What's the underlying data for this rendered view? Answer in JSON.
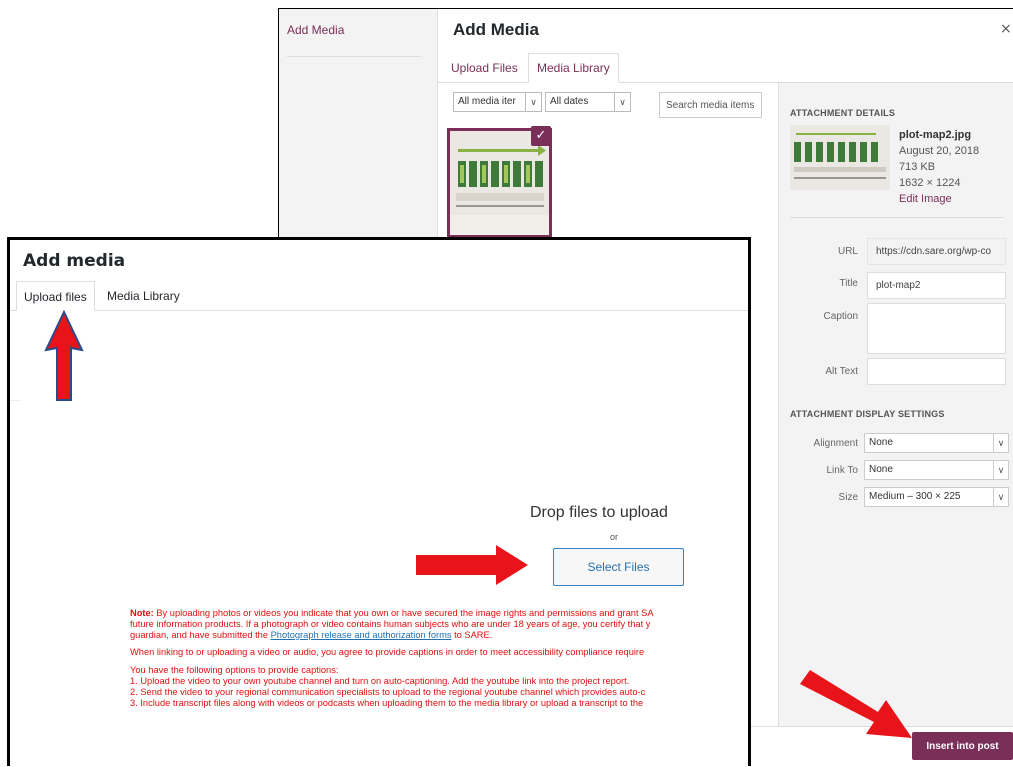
{
  "back_modal": {
    "menu_item": "Add Media",
    "title": "Add Media",
    "close_symbol": "×",
    "tabs": [
      "Upload Files",
      "Media Library"
    ],
    "filters": {
      "type": "All media iter",
      "date": "All dates"
    },
    "search_placeholder": "Search media items",
    "details": {
      "heading": "ATTACHMENT DETAILS",
      "filename": "plot-map2.jpg",
      "date": "August 20, 2018",
      "size": "713 KB",
      "dimensions": "1632 × 1224",
      "edit_link": "Edit Image",
      "url_label": "URL",
      "url_value": "https://cdn.sare.org/wp-co",
      "title_label": "Title",
      "title_value": "plot-map2",
      "caption_label": "Caption",
      "alt_label": "Alt Text"
    },
    "display": {
      "heading": "ATTACHMENT DISPLAY SETTINGS",
      "alignment_label": "Alignment",
      "alignment_value": "None",
      "link_label": "Link To",
      "link_value": "None",
      "size_label": "Size",
      "size_value": "Medium – 300 × 225"
    },
    "insert_button": "Insert into post"
  },
  "front_modal": {
    "title": "Add media",
    "tabs": [
      "Upload files",
      "Media Library"
    ],
    "drop_text": "Drop files to upload",
    "or_text": "or",
    "select_files": "Select Files",
    "note_label": "Note:",
    "note_line1": " By uploading photos or videos you indicate that you own or have secured the image rights and permissions and grant SA",
    "note_line2": "future information products. If a photograph or video contains human subjects who are under 18 years of age, you certify that y",
    "note_line3_pre": "guardian, and have submitted the ",
    "note_line3_link": "Photograph release and authorization forms",
    "note_line3_post": " to SARE.",
    "captions_line": "When linking to or uploading a video or audio, you agree to provide captions in order to meet accessibility compliance require",
    "options_intro": "You have the following options to provide captions:",
    "option1": "1. Upload the video to your own youtube channel and turn on auto-captioning. Add the youtube link into the project report.",
    "option2": "2. Send the video to your regional communication specialists to upload to the regional youtube channel which provides auto-c",
    "option3": "3. Include transcript files along with videos or podcasts when uploading them to the media library or upload a transcript to the"
  },
  "colors": {
    "accent": "#7a2f58",
    "notice_red": "#e0100f",
    "link_blue": "#2271b1",
    "arrow_red": "#e8141a",
    "arrow_blue": "#2b4a8a"
  }
}
